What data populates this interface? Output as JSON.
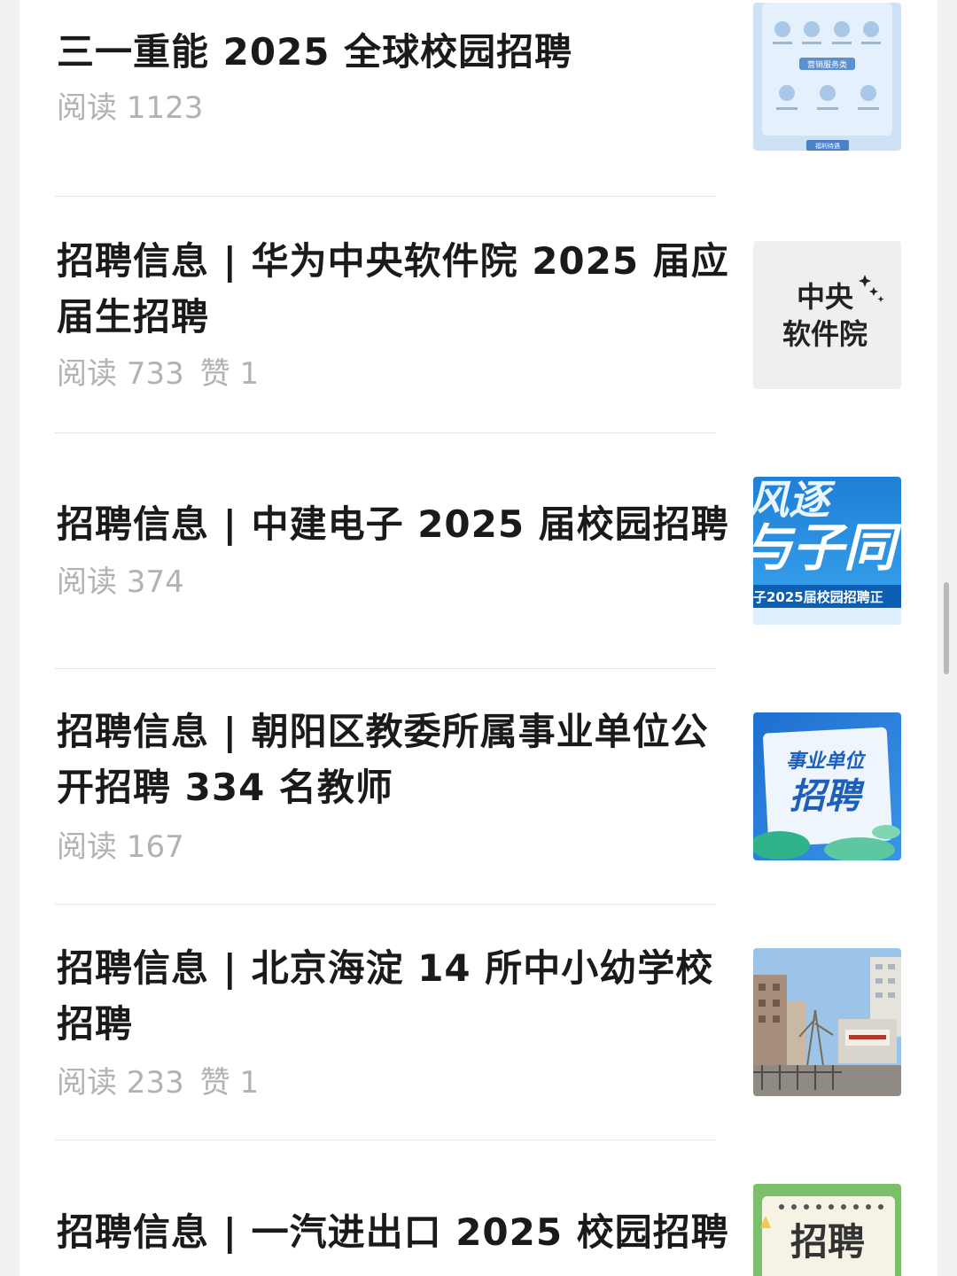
{
  "articles": [
    {
      "title": "三一重能 2025 全球校园招聘",
      "reads": "阅读 1123",
      "likes": "",
      "thumb_icon": "recruitment-poster-thumbnail",
      "thumb_text": [
        "营销服务类",
        "福利待遇"
      ]
    },
    {
      "title": "招聘信息 | 华为中央软件院 2025 届应届生招聘",
      "reads": "阅读 733",
      "likes": "赞 1",
      "thumb_icon": "central-software-institute-thumbnail",
      "thumb_text": [
        "中央",
        "软件院"
      ]
    },
    {
      "title": "招聘信息 | 中建电子 2025 届校园招聘",
      "reads": "阅读 374",
      "likes": "",
      "thumb_icon": "campus-recruitment-banner-thumbnail",
      "thumb_text": [
        "风逐",
        "与子同",
        "子2025届校园招聘正"
      ]
    },
    {
      "title": "招聘信息 | 朝阳区教委所属事业单位公开招聘 334 名教师",
      "reads": "阅读 167",
      "likes": "",
      "thumb_icon": "public-institution-recruitment-thumbnail",
      "thumb_text": [
        "事业单位",
        "招聘"
      ]
    },
    {
      "title": "招聘信息 | 北京海淀 14 所中小幼学校招聘",
      "reads": "阅读 233",
      "likes": "赞 1",
      "thumb_icon": "school-gate-photo-thumbnail",
      "thumb_text": []
    },
    {
      "title": "招聘信息 | 一汽进出口 2025 校园招聘",
      "reads": "",
      "likes": "",
      "thumb_icon": "green-recruitment-poster-thumbnail",
      "thumb_text": [
        "招聘"
      ]
    }
  ],
  "colors": {
    "title": "#1a1a1a",
    "meta": "#b2b2b2",
    "divider": "#e5e5e5",
    "background": "#f1f1f1",
    "panel": "#ffffff"
  }
}
